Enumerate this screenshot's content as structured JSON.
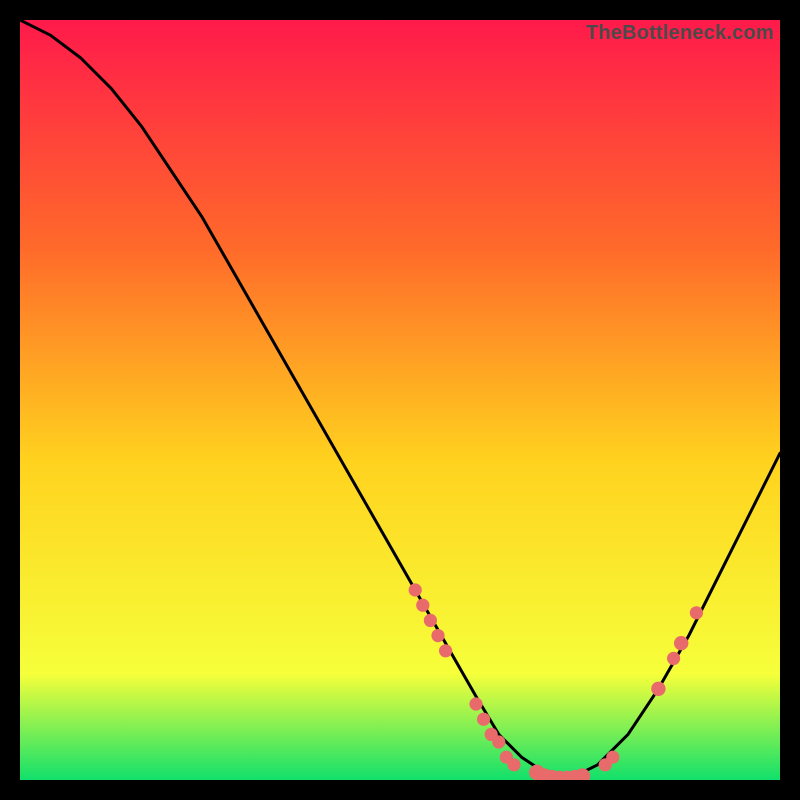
{
  "watermark": "TheBottleneck.com",
  "colors": {
    "gradient_top": "#ff1a4b",
    "gradient_mid1": "#ff6a2a",
    "gradient_mid2": "#ffd21e",
    "gradient_mid3": "#f6ff3a",
    "gradient_bottom": "#11e06b",
    "curve": "#000000",
    "marker": "#e86a6a",
    "frame": "#000000"
  },
  "chart_data": {
    "type": "line",
    "title": "",
    "xlabel": "",
    "ylabel": "",
    "xlim": [
      0,
      100
    ],
    "ylim": [
      0,
      100
    ],
    "series": [
      {
        "name": "bottleneck-curve",
        "x": [
          0,
          4,
          8,
          12,
          16,
          20,
          24,
          28,
          32,
          36,
          40,
          44,
          48,
          52,
          56,
          60,
          63,
          66,
          69,
          72,
          76,
          80,
          84,
          88,
          92,
          96,
          100
        ],
        "y": [
          100,
          98,
          95,
          91,
          86,
          80,
          74,
          67,
          60,
          53,
          46,
          39,
          32,
          25,
          18,
          11,
          6,
          3,
          1,
          0,
          2,
          6,
          12,
          19,
          27,
          35,
          43
        ]
      }
    ],
    "markers": [
      {
        "x": 52,
        "y": 25,
        "r": 1.1
      },
      {
        "x": 53,
        "y": 23,
        "r": 1.1
      },
      {
        "x": 54,
        "y": 21,
        "r": 1.1
      },
      {
        "x": 55,
        "y": 19,
        "r": 1.1
      },
      {
        "x": 56,
        "y": 17,
        "r": 1.1
      },
      {
        "x": 60,
        "y": 10,
        "r": 1.1
      },
      {
        "x": 61,
        "y": 8,
        "r": 1.1
      },
      {
        "x": 62,
        "y": 6,
        "r": 1.1
      },
      {
        "x": 63,
        "y": 5,
        "r": 1.1
      },
      {
        "x": 64,
        "y": 3,
        "r": 1.1
      },
      {
        "x": 65,
        "y": 2,
        "r": 1.1
      },
      {
        "x": 68,
        "y": 1,
        "r": 1.3
      },
      {
        "x": 69,
        "y": 0.5,
        "r": 1.3
      },
      {
        "x": 70,
        "y": 0.3,
        "r": 1.3
      },
      {
        "x": 71,
        "y": 0.2,
        "r": 1.3
      },
      {
        "x": 72,
        "y": 0.2,
        "r": 1.3
      },
      {
        "x": 73,
        "y": 0.3,
        "r": 1.3
      },
      {
        "x": 74,
        "y": 0.5,
        "r": 1.3
      },
      {
        "x": 77,
        "y": 2,
        "r": 1.1
      },
      {
        "x": 78,
        "y": 3,
        "r": 1.1
      },
      {
        "x": 84,
        "y": 12,
        "r": 1.2
      },
      {
        "x": 86,
        "y": 16,
        "r": 1.1
      },
      {
        "x": 87,
        "y": 18,
        "r": 1.2
      },
      {
        "x": 89,
        "y": 22,
        "r": 1.1
      }
    ]
  }
}
